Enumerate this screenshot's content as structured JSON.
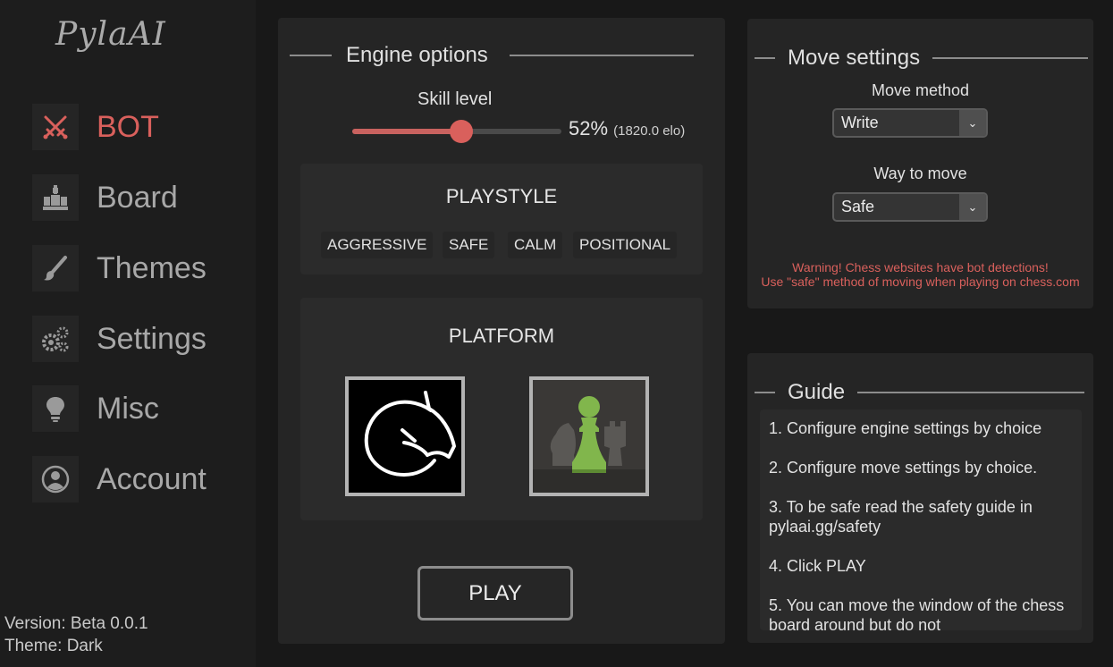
{
  "app": {
    "logo": "PylaAI"
  },
  "sidebar": {
    "items": [
      {
        "label": "BOT",
        "icon": "crossed-swords-icon",
        "active": true
      },
      {
        "label": "Board",
        "icon": "chess-pieces-icon",
        "active": false
      },
      {
        "label": "Themes",
        "icon": "paint-brush-icon",
        "active": false
      },
      {
        "label": "Settings",
        "icon": "gears-icon",
        "active": false
      },
      {
        "label": "Misc",
        "icon": "lightbulb-icon",
        "active": false
      },
      {
        "label": "Account",
        "icon": "user-circle-icon",
        "active": false
      }
    ],
    "version": "Version: Beta 0.0.1",
    "theme": "Theme: Dark"
  },
  "engine": {
    "title": "Engine options",
    "skill_label": "Skill level",
    "skill_percent": 52,
    "skill_percent_text": "52%",
    "skill_elo": "(1820.0 elo)",
    "playstyle": {
      "title": "PLAYSTYLE",
      "options": [
        "AGGRESSIVE",
        "SAFE",
        "CALM",
        "POSITIONAL"
      ]
    },
    "platform": {
      "title": "PLATFORM",
      "options": [
        {
          "name": "lichess",
          "icon": "lichess-knight-icon"
        },
        {
          "name": "chess.com",
          "icon": "chesscom-pawn-icon"
        }
      ]
    },
    "play_label": "PLAY"
  },
  "move": {
    "title": "Move settings",
    "method_label": "Move method",
    "method_value": "Write",
    "way_label": "Way to move",
    "way_value": "Safe",
    "warning_line1": "Warning! Chess websites have bot detections!",
    "warning_line2": "Use \"safe\" method of moving when playing on chess.com"
  },
  "guide": {
    "title": "Guide",
    "steps": [
      "1. Configure engine settings by choice",
      "2. Configure move settings by choice.",
      "3. To be safe read the safety guide in pylaai.gg/safety",
      "4. Click PLAY",
      "5. You can move the window of the chess board around but do not"
    ]
  },
  "colors": {
    "accent": "#d9605c",
    "panel": "#252525",
    "background": "#181818",
    "chesscom_green": "#7fa650"
  }
}
